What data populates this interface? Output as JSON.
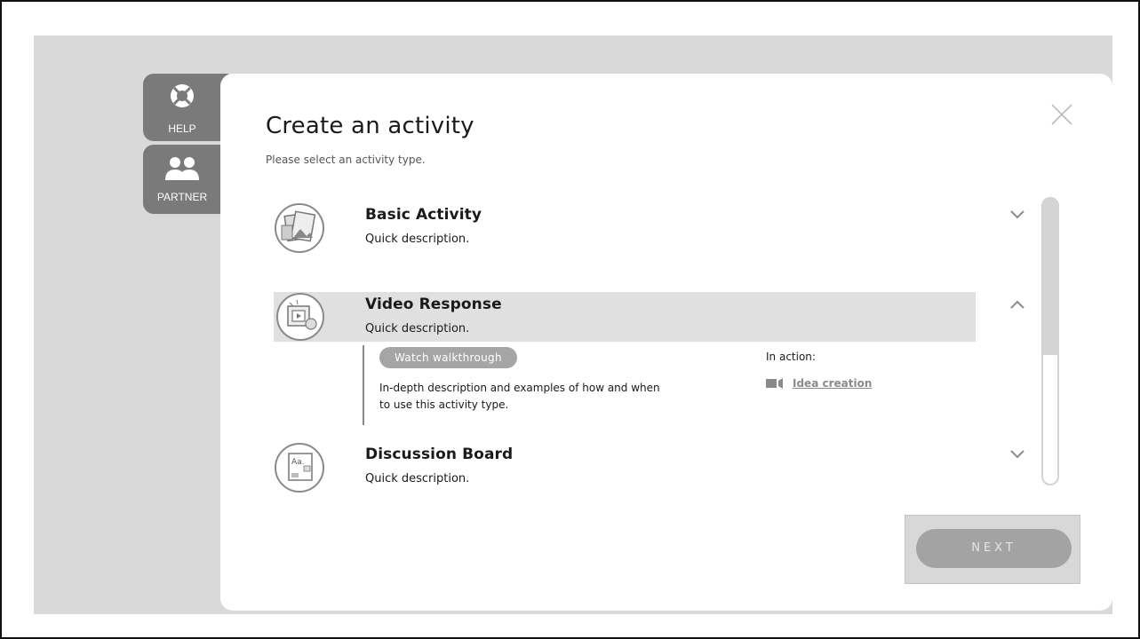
{
  "sidebar": {
    "help": {
      "label": "HELP",
      "icon": "lifebuoy-icon"
    },
    "partner": {
      "label": "PARTNER",
      "icon": "users-icon"
    }
  },
  "modal": {
    "title": "Create an activity",
    "subtitle": "Please select an activity type.",
    "close_icon": "close-icon"
  },
  "activities": [
    {
      "title": "Basic Activity",
      "description": "Quick description.",
      "icon": "photo-gallery-icon",
      "expanded": false
    },
    {
      "title": "Video Response",
      "description": "Quick description.",
      "icon": "video-player-icon",
      "expanded": true
    },
    {
      "title": "Discussion Board",
      "description": "Quick description.",
      "icon": "text-document-icon",
      "expanded": false
    }
  ],
  "expanded_panel": {
    "walkthrough_label": "Watch walkthrough",
    "description": "In-depth description and examples of how and when to use this activity type.",
    "in_action_label": "In action:",
    "in_action_link": "Idea creation",
    "link_icon": "video-camera-icon"
  },
  "footer": {
    "next_label": "NEXT"
  },
  "colors": {
    "panel_bg": "#d9d9d9",
    "tab_bg": "#7a7a7a",
    "selected_row": "#e0e0e0",
    "button_disabled": "#a3a3a3"
  }
}
